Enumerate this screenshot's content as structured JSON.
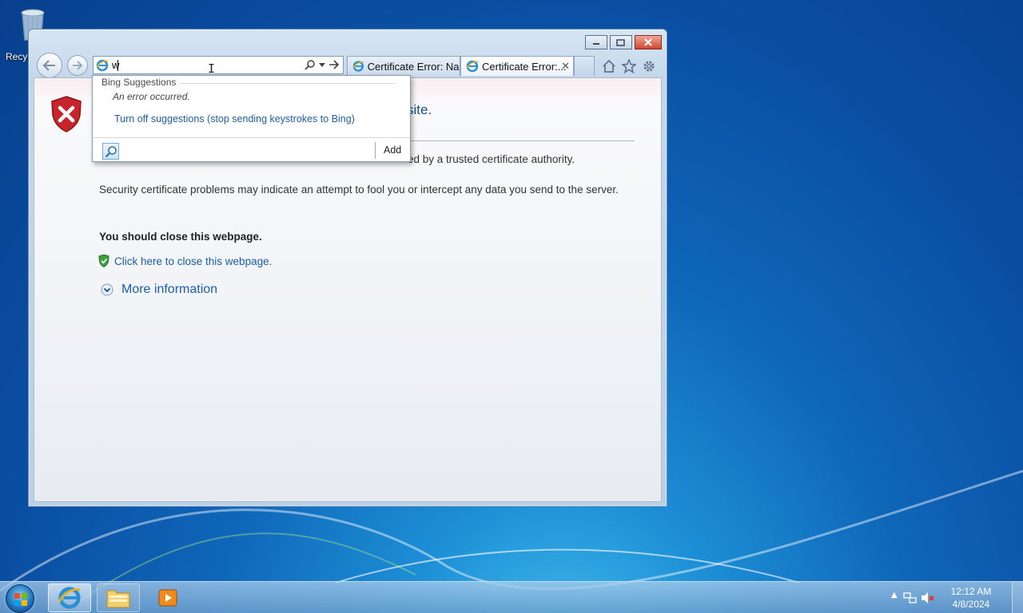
{
  "desktop": {
    "recycle_bin_label": "Recyc"
  },
  "browser": {
    "address_value": "w",
    "tabs": [
      {
        "label": "Certificate Error: Na..."
      },
      {
        "label": "Certificate Error:..."
      }
    ],
    "tab_close_glyph": "✕"
  },
  "page": {
    "heading": "site.",
    "paragraph1": "ed by a trusted certificate authority.",
    "paragraph2": "Security certificate problems may indicate an attempt to fool you or intercept any data you send to the server.",
    "paragraph3": "You should close this webpage.",
    "close_link": "Click here to close this webpage.",
    "more_info": "More information"
  },
  "suggestions": {
    "header": "Bing Suggestions",
    "error": "An error occurred.",
    "turn_off": "Turn off suggestions (stop sending keystrokes to Bing)",
    "add": "Add"
  },
  "taskbar": {
    "time": "12:12 AM",
    "date": "4/8/2024"
  },
  "icons": [
    "recycle-bin-icon",
    "ie-icon",
    "search-icon",
    "go-arrow-icon",
    "home-icon",
    "favorites-star-icon",
    "gear-icon",
    "shield-error-icon",
    "green-shield-icon",
    "expand-chevron-icon",
    "folder-icon",
    "media-player-icon",
    "network-icon",
    "volume-muted-icon"
  ],
  "colors": {
    "link": "#1a5fa8",
    "heading": "#1a4b8c",
    "error_shield": "#c8242b",
    "desktop_blue": "#0f66b9"
  }
}
